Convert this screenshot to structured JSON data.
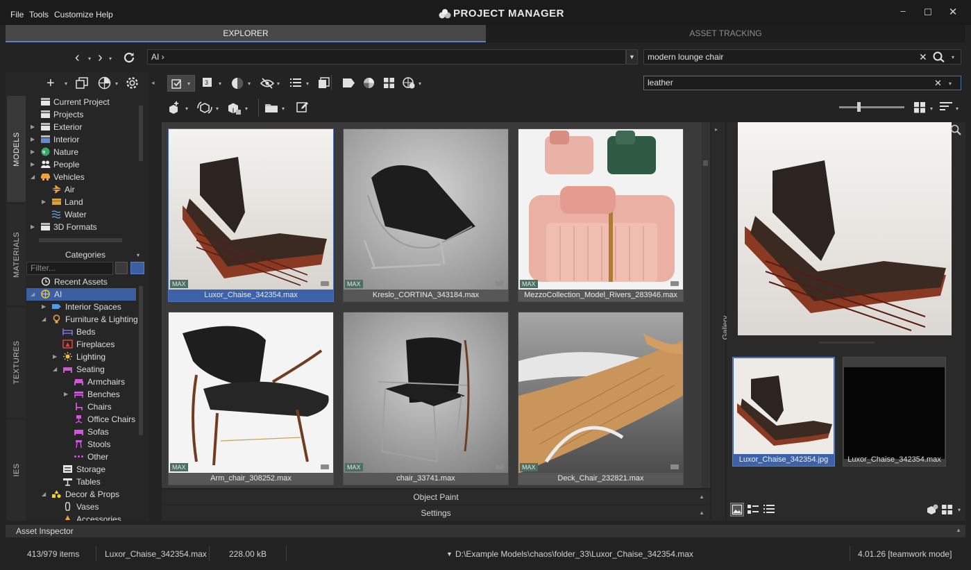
{
  "menu": [
    "File",
    "Tools",
    "Customize",
    "Help"
  ],
  "app_title": "PROJECT MANAGER",
  "window_controls": {
    "minimize": "–",
    "maximize": "☐",
    "close": "✕"
  },
  "main_tabs": [
    {
      "label": "EXPLORER",
      "active": true
    },
    {
      "label": "ASSET TRACKING",
      "active": false
    }
  ],
  "path_input": "AI ›",
  "search": {
    "query": "modern lounge chair",
    "filter": "leather"
  },
  "side_tabs": [
    "MODELS",
    "MATERIALS",
    "TEXTURES",
    "IES"
  ],
  "folders": [
    {
      "label": "Current Project",
      "icon": "folder-stack-icon"
    },
    {
      "label": "Projects",
      "icon": "folder-stack-icon"
    },
    {
      "label": "Exterior",
      "icon": "building-icon"
    },
    {
      "label": "Interior",
      "icon": "sofa-icon"
    },
    {
      "label": "Nature",
      "icon": "globe-icon"
    },
    {
      "label": "People",
      "icon": "people-icon"
    },
    {
      "label": "Vehicles",
      "icon": "car-icon"
    },
    {
      "label": "Air",
      "icon": "plane-icon"
    },
    {
      "label": "Land",
      "icon": "truck-icon"
    },
    {
      "label": "Water",
      "icon": "water-icon"
    },
    {
      "label": "3D Formats",
      "icon": "folder-stack-icon"
    }
  ],
  "categories": {
    "header": "Categories",
    "filter_placeholder": "Filter...",
    "items": [
      {
        "label": "Recent Assets",
        "icon": "history-icon"
      },
      {
        "label": "AI",
        "icon": "ai-globe-icon"
      },
      {
        "label": "Interior Spaces",
        "icon": "room-icon"
      },
      {
        "label": "Furniture & Lighting",
        "icon": "bulb-icon"
      },
      {
        "label": "Beds",
        "icon": "bed-icon"
      },
      {
        "label": "Fireplaces",
        "icon": "fireplace-icon"
      },
      {
        "label": "Lighting",
        "icon": "sun-icon"
      },
      {
        "label": "Seating",
        "icon": "seat-icon"
      },
      {
        "label": "Armchairs",
        "icon": "armchair-icon"
      },
      {
        "label": "Benches",
        "icon": "bench-icon"
      },
      {
        "label": "Chairs",
        "icon": "chair-icon"
      },
      {
        "label": "Office Chairs",
        "icon": "office-chair-icon"
      },
      {
        "label": "Sofas",
        "icon": "sofa-icon"
      },
      {
        "label": "Stools",
        "icon": "stool-icon"
      },
      {
        "label": "Other",
        "icon": "dots-icon"
      },
      {
        "label": "Storage",
        "icon": "storage-icon"
      },
      {
        "label": "Tables",
        "icon": "table-icon"
      },
      {
        "label": "Decor & Props",
        "icon": "shapes-icon"
      },
      {
        "label": "Vases",
        "icon": "vase-icon"
      },
      {
        "label": "Accessories",
        "icon": "lamp-icon"
      }
    ]
  },
  "assets": [
    {
      "name": "Luxor_Chaise_342354.max",
      "badge": "MAX"
    },
    {
      "name": "Kreslo_CORTINA_343184.max",
      "badge": "MAX"
    },
    {
      "name": "MezzoCollection_Model_Rivers_283946.max",
      "badge": "MAX"
    },
    {
      "name": "Arm_chair_308252.max",
      "badge": "MAX"
    },
    {
      "name": "chair_33741.max",
      "badge": "MAX"
    },
    {
      "name": "Deck_Chair_232821.max",
      "badge": "MAX"
    }
  ],
  "bottom_panels": {
    "object_paint": "Object Paint",
    "settings": "Settings"
  },
  "gallery": {
    "label": "Gallery",
    "files": [
      "Luxor_Chaise_342354.jpg",
      "Luxor_Chaise_342354.max"
    ]
  },
  "asset_inspector": "Asset Inspector",
  "status": {
    "items": "413/979 items",
    "selected": "Luxor_Chaise_342354.max",
    "size": "228.00 kB",
    "path": "D:\\Example Models\\chaos\\folder_33\\Luxor_Chaise_342354.max",
    "version": "4.01.26 [teamwork mode]"
  },
  "colors": {
    "accent": "#4f74bb",
    "selection": "#3d62a8",
    "badge": "#4c6e63"
  }
}
